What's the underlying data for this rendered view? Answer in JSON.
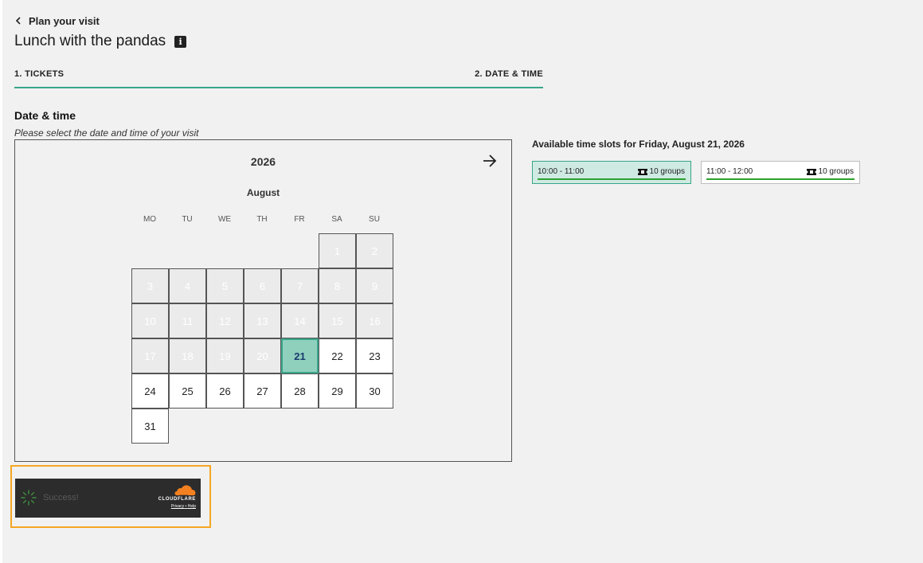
{
  "header": {
    "back_label": "Plan your visit",
    "title": "Lunch with the pandas"
  },
  "steps": [
    {
      "label": "1. TICKETS"
    },
    {
      "label": "2. DATE & TIME"
    }
  ],
  "section": {
    "title": "Date & time",
    "subtitle": "Please select the date and time of your visit"
  },
  "calendar": {
    "year": "2026",
    "month": "August",
    "weekdays": [
      "MO",
      "TU",
      "WE",
      "TH",
      "FR",
      "SA",
      "SU"
    ],
    "days": [
      "1",
      "2",
      "3",
      "4",
      "5",
      "6",
      "7",
      "8",
      "9",
      "10",
      "11",
      "12",
      "13",
      "14",
      "15",
      "16",
      "17",
      "18",
      "19",
      "20",
      "21",
      "22",
      "23",
      "24",
      "25",
      "26",
      "27",
      "28",
      "29",
      "30",
      "31"
    ],
    "selected_day": "21"
  },
  "slots": {
    "title": "Available time slots for Friday, August 21, 2026",
    "items": [
      {
        "time": "10:00 - 11:00",
        "groups": "10 groups"
      },
      {
        "time": "11:00 - 12:00",
        "groups": "10 groups"
      }
    ]
  },
  "captcha": {
    "status": "Success!",
    "brand": "CLOUDFLARE",
    "privacy": "Privacy",
    "separator": "•",
    "help": "Help"
  },
  "colors": {
    "accent": "#3aa58a",
    "selected_fill": "#8fd0bd",
    "slot_bar": "#2ea12e",
    "frame": "#f5a623"
  }
}
